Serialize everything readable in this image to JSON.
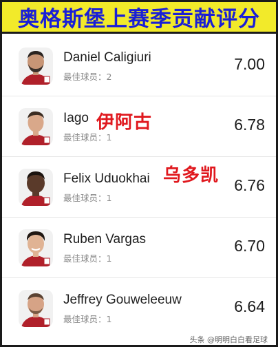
{
  "title": "奥格斯堡上赛季贡献评分",
  "players": [
    {
      "name": "Daniel Caligiuri",
      "sub": "最佳球员：2",
      "score": "7.00"
    },
    {
      "name": "Iago",
      "sub": "最佳球员：1",
      "score": "6.78"
    },
    {
      "name": "Felix Uduokhai",
      "sub": "最佳球员：1",
      "score": "6.76"
    },
    {
      "name": "Ruben Vargas",
      "sub": "最佳球员：1",
      "score": "6.70"
    },
    {
      "name": "Jeffrey Gouweleeuw",
      "sub": "最佳球员：1",
      "score": "6.64"
    }
  ],
  "overlays": {
    "iago_cn": "伊阿古",
    "uduokhai_cn": "乌多凯"
  },
  "watermark": "头条 @明明白白看足球",
  "colors": {
    "title_bg": "#f2ea2a",
    "title_text": "#1a1fd6",
    "overlay_text": "#e0181e"
  }
}
